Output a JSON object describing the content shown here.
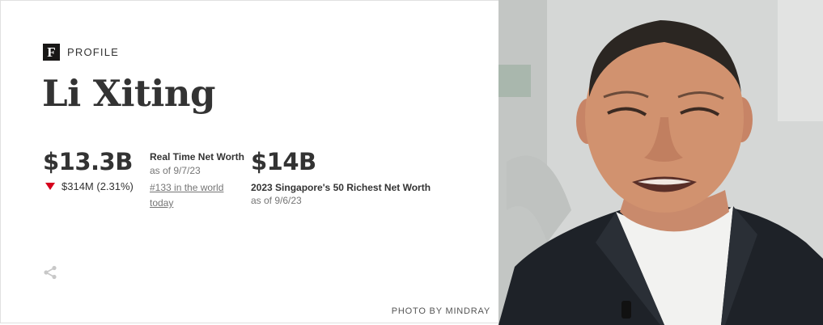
{
  "profile": {
    "brand_letter": "F",
    "section_label": "PROFILE",
    "name": "Li Xiting"
  },
  "real_time": {
    "net_worth": "$13.3B",
    "change": "$314M (2.31%)",
    "change_direction": "down",
    "label": "Real Time Net Worth",
    "as_of": "as of 9/7/23",
    "rank_text": "#133 in the world today"
  },
  "list": {
    "net_worth": "$14B",
    "label": "2023 Singapore's 50 Richest Net Worth",
    "as_of": "as of 9/6/23"
  },
  "footer": {
    "photo_credit": "PHOTO BY MINDRAY"
  },
  "colors": {
    "down": "#d6001c",
    "text": "#333333",
    "muted": "#757575",
    "suit": "#1e2228"
  },
  "icons": {
    "share": "share-icon",
    "brand": "forbes-f-logo"
  }
}
